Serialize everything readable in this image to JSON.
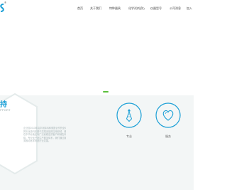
{
  "header": {
    "logo_suffix": "®",
    "nav": [
      {
        "label": "首页"
      },
      {
        "label": "关于我们"
      },
      {
        "label": "特种器具"
      },
      {
        "label": "化学试剂(防)"
      },
      {
        "label": "仪器型号"
      },
      {
        "label": "公司消息"
      },
      {
        "label": "加入"
      }
    ]
  },
  "support": {
    "title": "持",
    "subtitle": "PPORT",
    "intro_lines": [
      "企业自2013年由华润涂料和德国合作的全球",
      "的氧化涂料在基于高端涂装的应用领域，借",
      "在中华北地区有广泛而稳定的客户和销售网",
      "络，专业化产品生产服务体系，我们通过服",
      "务推动化学药品行业发展。"
    ]
  },
  "features": [
    {
      "label": "专业",
      "icon": "tie-icon"
    },
    {
      "label": "服务",
      "icon": "heart-icon"
    }
  ],
  "colors": {
    "accent": "#1a9fd6",
    "green": "#5bbf3c",
    "lower_bg": "#f3f6f6"
  }
}
